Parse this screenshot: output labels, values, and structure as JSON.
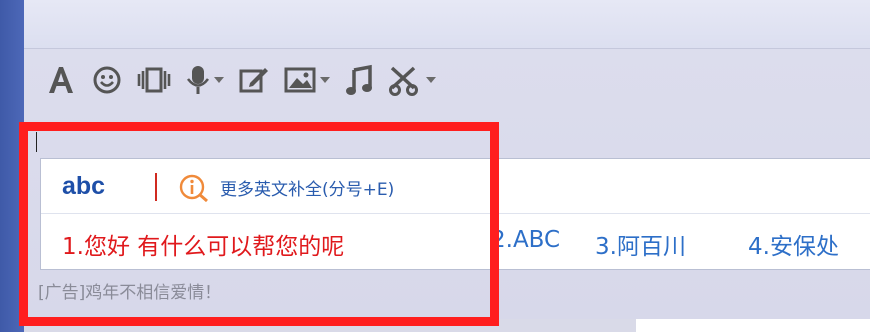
{
  "toolbar": {
    "items": [
      {
        "name": "font-icon"
      },
      {
        "name": "emoji-icon"
      },
      {
        "name": "vibrate-icon"
      },
      {
        "name": "voice-icon",
        "dropdown": true
      },
      {
        "name": "edit-note-icon"
      },
      {
        "name": "image-icon",
        "dropdown": true
      },
      {
        "name": "music-icon"
      },
      {
        "name": "scissors-icon",
        "dropdown": true
      }
    ]
  },
  "ime": {
    "composition": "abc",
    "more_label": "更多英文补全(分号+E)",
    "candidates": [
      "1.您好 有什么可以帮您的呢",
      "2.ABC",
      "3.阿百川",
      "4.安保处"
    ]
  },
  "ad_text": "[广告]鸡年不相信爱情！",
  "colors": {
    "highlight": "#ff1e1e",
    "candidate_first": "#e0191c",
    "candidate_other": "#2d6fc8"
  }
}
